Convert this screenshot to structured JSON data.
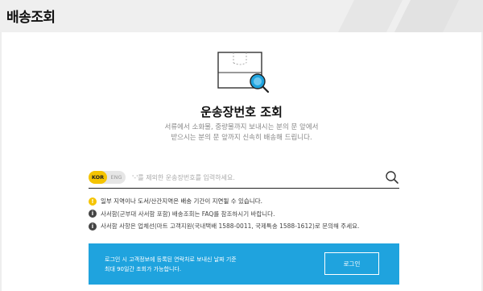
{
  "header": {
    "title": "배송조회"
  },
  "main": {
    "title": "운송장번호 조회",
    "desc_line1": "서류에서 소화물, 중량물까지 보내시는 분의 문 앞에서",
    "desc_line2": "받으시는 분의 문 앞까지 신속히 배송해 드립니다."
  },
  "search": {
    "lang_kor": "KOR",
    "lang_eng": "ENG",
    "placeholder": "'-'를 제외한 운송장번호를 입력하세요.",
    "value": ""
  },
  "notices": [
    {
      "type": "warning",
      "icon": "!",
      "text": "일부 지역이나 도서/산간지역은 배송 기간이 지연될 수 있습니다."
    },
    {
      "type": "info",
      "icon": "i",
      "text": "사서함(군부대 사서함 포함) 배송조회는 FAQ를 참조하시기 바랍니다."
    },
    {
      "type": "info",
      "icon": "i",
      "text": "사서함 사항은 업체선(마트 고객지원(국내택배 1588-0011, 국제특송 1588-1612)로 문의해 주세요."
    }
  ],
  "banner": {
    "line1": "로그인 시 고객정보에 등록된 연락처로 보내신 날짜 기준",
    "line2": "최대 90일간 조회가 가능합니다.",
    "button": "로그인"
  },
  "colors": {
    "accent_yellow": "#f5c400",
    "banner_blue": "#1fa3de",
    "header_bg": "#efefef"
  }
}
